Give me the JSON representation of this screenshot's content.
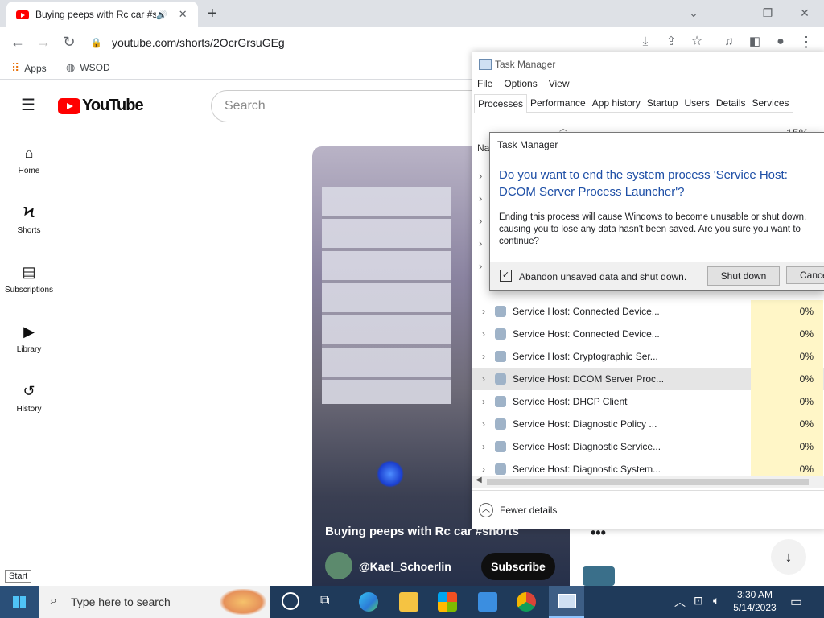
{
  "browser": {
    "tab_title": "Buying peeps with Rc car #sh",
    "url": "youtube.com/shorts/2OcrGrsuGEg",
    "bookmarks": [
      "Apps",
      "WSOD"
    ]
  },
  "youtube": {
    "wordmark": "YouTube",
    "search_placeholder": "Search",
    "guide": [
      "Home",
      "Shorts",
      "Subscriptions",
      "Library",
      "History"
    ],
    "short_title": "Buying peeps with Rc car #shorts",
    "channel": "@Kael_Schoerlin",
    "subscribe": "Subscribe"
  },
  "task_manager": {
    "title": "Task Manager",
    "menu": [
      "File",
      "Options",
      "View"
    ],
    "tabs": [
      "Processes",
      "Performance",
      "App history",
      "Startup",
      "Users",
      "Details",
      "Services"
    ],
    "cpu_header": "15%",
    "name_header": "Na",
    "processes": [
      {
        "name": "Service Host: Connected Device...",
        "cpu": "0%"
      },
      {
        "name": "Service Host: Connected Device...",
        "cpu": "0%"
      },
      {
        "name": "Service Host: Cryptographic Ser...",
        "cpu": "0%"
      },
      {
        "name": "Service Host: DCOM Server Proc...",
        "cpu": "0%"
      },
      {
        "name": "Service Host: DHCP Client",
        "cpu": "0%"
      },
      {
        "name": "Service Host: Diagnostic Policy ...",
        "cpu": "0%"
      },
      {
        "name": "Service Host: Diagnostic Service...",
        "cpu": "0%"
      },
      {
        "name": "Service Host: Diagnostic System...",
        "cpu": "0%"
      }
    ],
    "fewer_details": "Fewer details"
  },
  "dialog": {
    "title": "Task Manager",
    "question": "Do you want to end the system process 'Service Host: DCOM Server Process Launcher'?",
    "body": "Ending this process will cause Windows to become unusable or shut down, causing you to lose any data hasn't been saved. Are you sure you want to continue?",
    "checkbox_label": "Abandon unsaved data and shut down.",
    "shutdown": "Shut down",
    "cancel": "Cancel"
  },
  "taskbar": {
    "search_placeholder": "Type here to search",
    "time": "3:30 AM",
    "date": "5/14/2023",
    "start_tooltip": "Start"
  }
}
